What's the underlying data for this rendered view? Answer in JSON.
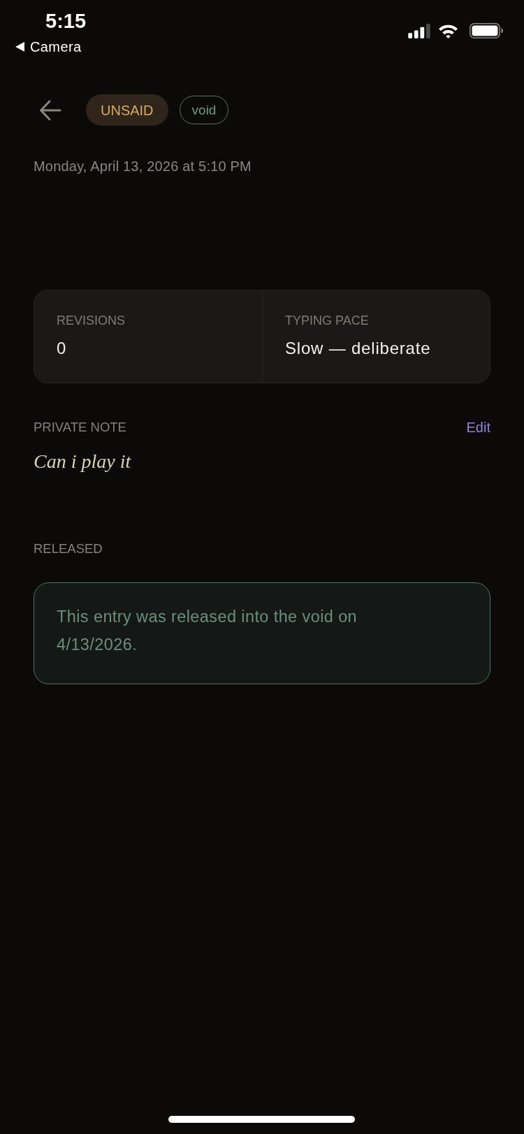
{
  "status_bar": {
    "time": "5:15",
    "back_app": "Camera"
  },
  "header": {
    "tags": [
      {
        "label": "UNSAID",
        "kind": "filled"
      },
      {
        "label": "void",
        "kind": "outlined"
      }
    ]
  },
  "date": "Monday, April 13, 2026 at 5:10 PM",
  "stats": [
    {
      "label": "REVISIONS",
      "value": "0"
    },
    {
      "label": "TYPING PACE",
      "value": "Slow — deliberate"
    }
  ],
  "private_note": {
    "heading": "PRIVATE NOTE",
    "action": "Edit",
    "text": "Can i play it"
  },
  "released": {
    "heading": "RELEASED",
    "message": "This entry was released into the void on 4/13/2026."
  }
}
